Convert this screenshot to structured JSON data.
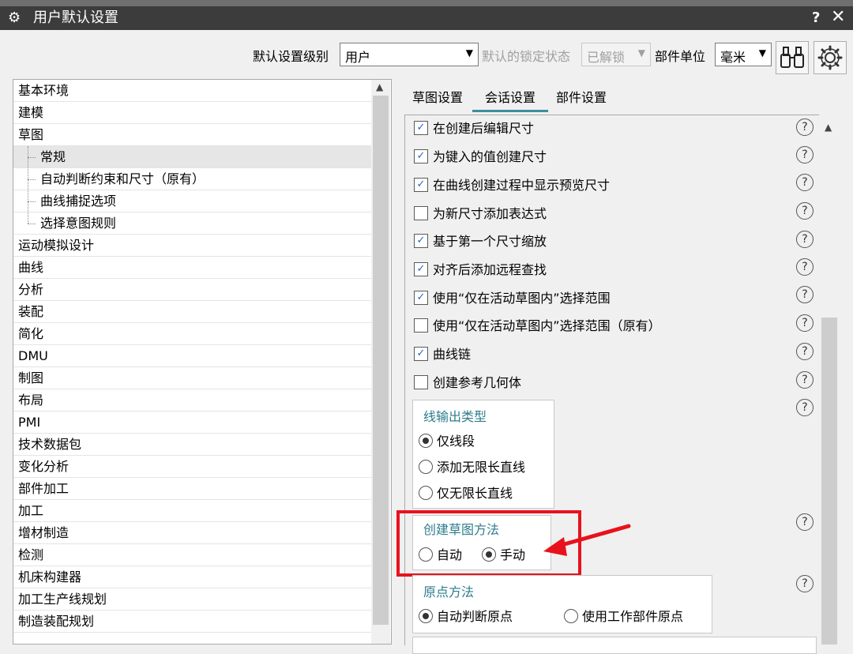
{
  "window": {
    "title": "用户默认设置",
    "help_label": "?",
    "close_label": "✕"
  },
  "toolbar": {
    "level_label": "默认设置级别",
    "level_value": "用户",
    "lock_label": "默认的锁定状态",
    "lock_value": "已解锁",
    "unit_label": "部件单位",
    "unit_value": "毫米",
    "find_icon": "binoculars-icon",
    "settings_icon": "gear-icon"
  },
  "tree": {
    "items": [
      {
        "label": "基本环境",
        "level": 0,
        "selected": false
      },
      {
        "label": "建模",
        "level": 0,
        "selected": false
      },
      {
        "label": "草图",
        "level": 0,
        "selected": false
      },
      {
        "label": "常规",
        "level": 1,
        "selected": true
      },
      {
        "label": "自动判断约束和尺寸（原有）",
        "level": 1,
        "selected": false
      },
      {
        "label": "曲线捕捉选项",
        "level": 1,
        "selected": false
      },
      {
        "label": "选择意图规则",
        "level": 1,
        "selected": false
      },
      {
        "label": "运动模拟设计",
        "level": 0,
        "selected": false
      },
      {
        "label": "曲线",
        "level": 0,
        "selected": false
      },
      {
        "label": "分析",
        "level": 0,
        "selected": false
      },
      {
        "label": "装配",
        "level": 0,
        "selected": false
      },
      {
        "label": "简化",
        "level": 0,
        "selected": false
      },
      {
        "label": "DMU",
        "level": 0,
        "selected": false
      },
      {
        "label": "制图",
        "level": 0,
        "selected": false
      },
      {
        "label": "布局",
        "level": 0,
        "selected": false
      },
      {
        "label": "PMI",
        "level": 0,
        "selected": false
      },
      {
        "label": "技术数据包",
        "level": 0,
        "selected": false
      },
      {
        "label": "变化分析",
        "level": 0,
        "selected": false
      },
      {
        "label": "部件加工",
        "level": 0,
        "selected": false
      },
      {
        "label": "加工",
        "level": 0,
        "selected": false
      },
      {
        "label": "增材制造",
        "level": 0,
        "selected": false
      },
      {
        "label": "检测",
        "level": 0,
        "selected": false
      },
      {
        "label": "机床构建器",
        "level": 0,
        "selected": false
      },
      {
        "label": "加工生产线规划",
        "level": 0,
        "selected": false
      },
      {
        "label": "制造装配规划",
        "level": 0,
        "selected": false
      }
    ]
  },
  "tabs": [
    {
      "label": "草图设置",
      "active": false
    },
    {
      "label": "会话设置",
      "active": true
    },
    {
      "label": "部件设置",
      "active": false
    }
  ],
  "options": [
    {
      "label": "在创建后编辑尺寸",
      "checked": true
    },
    {
      "label": "为键入的值创建尺寸",
      "checked": true
    },
    {
      "label": "在曲线创建过程中显示预览尺寸",
      "checked": true
    },
    {
      "label": "为新尺寸添加表达式",
      "checked": false
    },
    {
      "label": "基于第一个尺寸缩放",
      "checked": true
    },
    {
      "label": "对齐后添加远程查找",
      "checked": true
    },
    {
      "label": "使用“仅在活动草图内”选择范围",
      "checked": true
    },
    {
      "label": "使用“仅在活动草图内”选择范围（原有）",
      "checked": false
    },
    {
      "label": "曲线链",
      "checked": true
    },
    {
      "label": "创建参考几何体",
      "checked": false
    }
  ],
  "line_output": {
    "title": "线输出类型",
    "options": [
      {
        "label": "仅线段",
        "selected": true
      },
      {
        "label": "添加无限长直线",
        "selected": false
      },
      {
        "label": "仅无限长直线",
        "selected": false
      }
    ]
  },
  "sketch_method": {
    "title": "创建草图方法",
    "options": [
      {
        "label": "自动",
        "selected": false
      },
      {
        "label": "手动",
        "selected": true
      }
    ]
  },
  "origin_method": {
    "title": "原点方法",
    "options": [
      {
        "label": "自动判断原点",
        "selected": true
      },
      {
        "label": "使用工作部件原点",
        "selected": false
      }
    ]
  },
  "help_symbol": "?",
  "colors": {
    "group_title": "#2e7c8c",
    "annotation": "#e8121c",
    "title_bar": "#3c3c3c"
  }
}
